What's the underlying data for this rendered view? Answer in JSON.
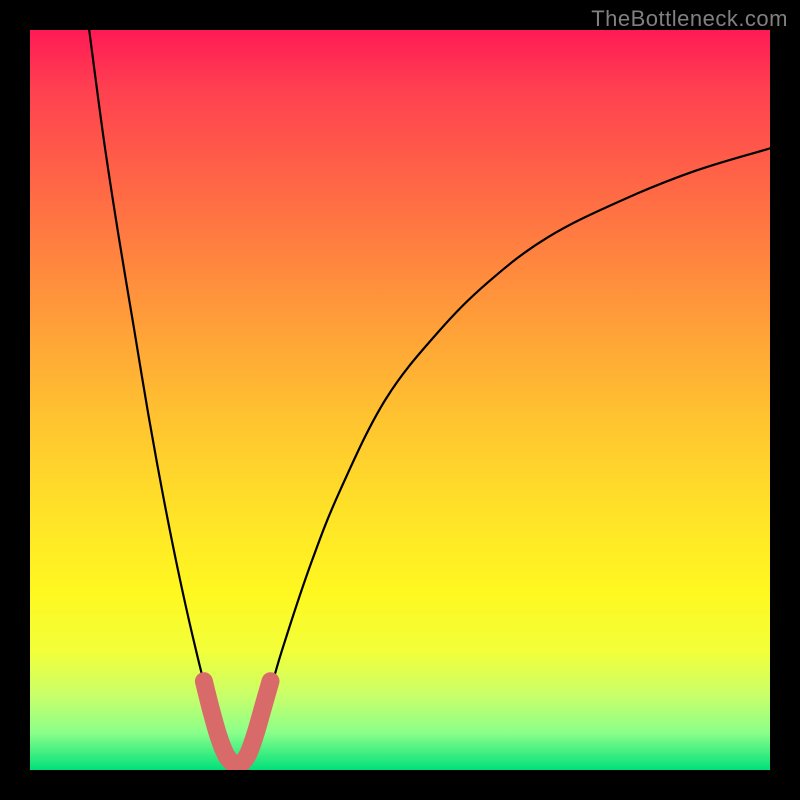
{
  "watermark": "TheBottleneck.com",
  "chart_data": {
    "type": "line",
    "title": "",
    "xlabel": "",
    "ylabel": "",
    "xlim": [
      0,
      100
    ],
    "ylim": [
      0,
      100
    ],
    "series": [
      {
        "name": "bottleneck-curve",
        "x": [
          8,
          10,
          12,
          14,
          16,
          18,
          20,
          22,
          24,
          26,
          27,
          28,
          29,
          30,
          32,
          34,
          38,
          42,
          48,
          55,
          62,
          70,
          80,
          90,
          100
        ],
        "y": [
          100,
          85,
          72,
          60,
          48,
          37,
          27,
          18,
          10,
          4,
          1,
          0,
          1,
          3,
          9,
          16,
          28,
          38,
          50,
          59,
          66,
          72,
          77,
          81,
          84
        ]
      },
      {
        "name": "optimal-marker",
        "x": [
          23.5,
          24.5,
          25.5,
          26.5,
          27.5,
          28,
          28.5,
          29.5,
          30.5,
          31.5,
          32.5
        ],
        "y": [
          12,
          8,
          4.5,
          2,
          0.8,
          0.5,
          0.8,
          2.2,
          5,
          8.5,
          12
        ]
      }
    ],
    "gradient_stops": [
      {
        "pos": 0,
        "color": "#ff1a55"
      },
      {
        "pos": 50,
        "color": "#ffd028"
      },
      {
        "pos": 100,
        "color": "#00e07a"
      }
    ]
  }
}
